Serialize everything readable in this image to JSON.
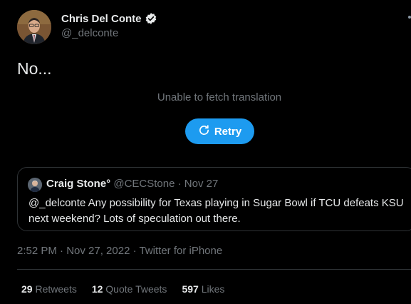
{
  "author": {
    "name": "Chris Del Conte",
    "handle": "@_delconte"
  },
  "tweet": {
    "text": "No..."
  },
  "translation": {
    "message": "Unable to fetch translation",
    "retry_label": "Retry"
  },
  "quote": {
    "name": "Craig Stone°",
    "handle": "@CECStone",
    "date": "· Nov 27",
    "text": "@_delconte Any possibility for Texas playing in Sugar Bowl if TCU defeats KSU next weekend? Lots of speculation out there."
  },
  "meta": {
    "timestamp": "2:52 PM · Nov 27, 2022 · Twitter for iPhone"
  },
  "stats": {
    "retweets_count": "29",
    "retweets_label": "Retweets",
    "quotes_count": "12",
    "quotes_label": "Quote Tweets",
    "likes_count": "597",
    "likes_label": "Likes"
  },
  "colors": {
    "accent": "#1d9bf0",
    "background": "#000000",
    "secondary_text": "#71767b",
    "border": "#2f3336"
  }
}
